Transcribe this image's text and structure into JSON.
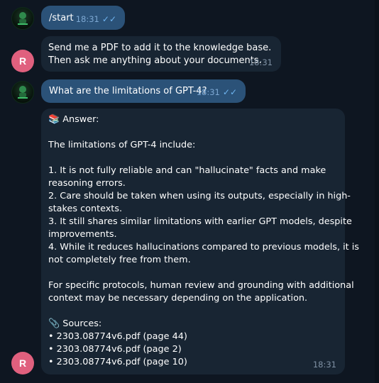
{
  "chat": {
    "bot_avatar_icon": "robot-logo-icon",
    "user_initial": "R",
    "msg1": {
      "text": "/start",
      "time": "18:31"
    },
    "msg2": {
      "line1": "Send me a PDF to add it to the knowledge base.",
      "line2": "Then ask me anything about your documents.",
      "time": "18:31"
    },
    "msg3": {
      "text": "What are the limitations of GPT-4?",
      "time": "18:31"
    },
    "msg4": {
      "answer_icon": "books-icon",
      "answer_label": "Answer:",
      "intro": "The limitations of GPT-4 include:",
      "l1a": "1. It is not fully reliable and can \"hallucinate\" facts and make",
      "l1b": "reasoning errors.",
      "l2a": "2. Care should be taken when using its outputs, especially in high-",
      "l2b": "stakes contexts.",
      "l3a": "3. It still shares similar limitations with earlier GPT models, despite",
      "l3b": "improvements.",
      "l4a": "4. While it reduces hallucinations compared to previous models, it is",
      "l4b": "not completely free from them.",
      "p2a": "For specific protocols, human review and grounding with additional",
      "p2b": "context may be necessary depending on the application.",
      "sources_icon": "paperclip-icon",
      "sources_label": "Sources:",
      "sources": [
        "• 2303.08774v6.pdf (page 44)",
        "• 2303.08774v6.pdf (page 2)",
        "• 2303.08774v6.pdf (page 10)"
      ],
      "time": "18:31"
    }
  },
  "colors": {
    "background": "#0e1621",
    "outgoing_bubble": "#2b5278",
    "incoming_bubble": "#182533",
    "user_avatar": "#e0607e",
    "read_ticks": "#6fb4f0"
  }
}
